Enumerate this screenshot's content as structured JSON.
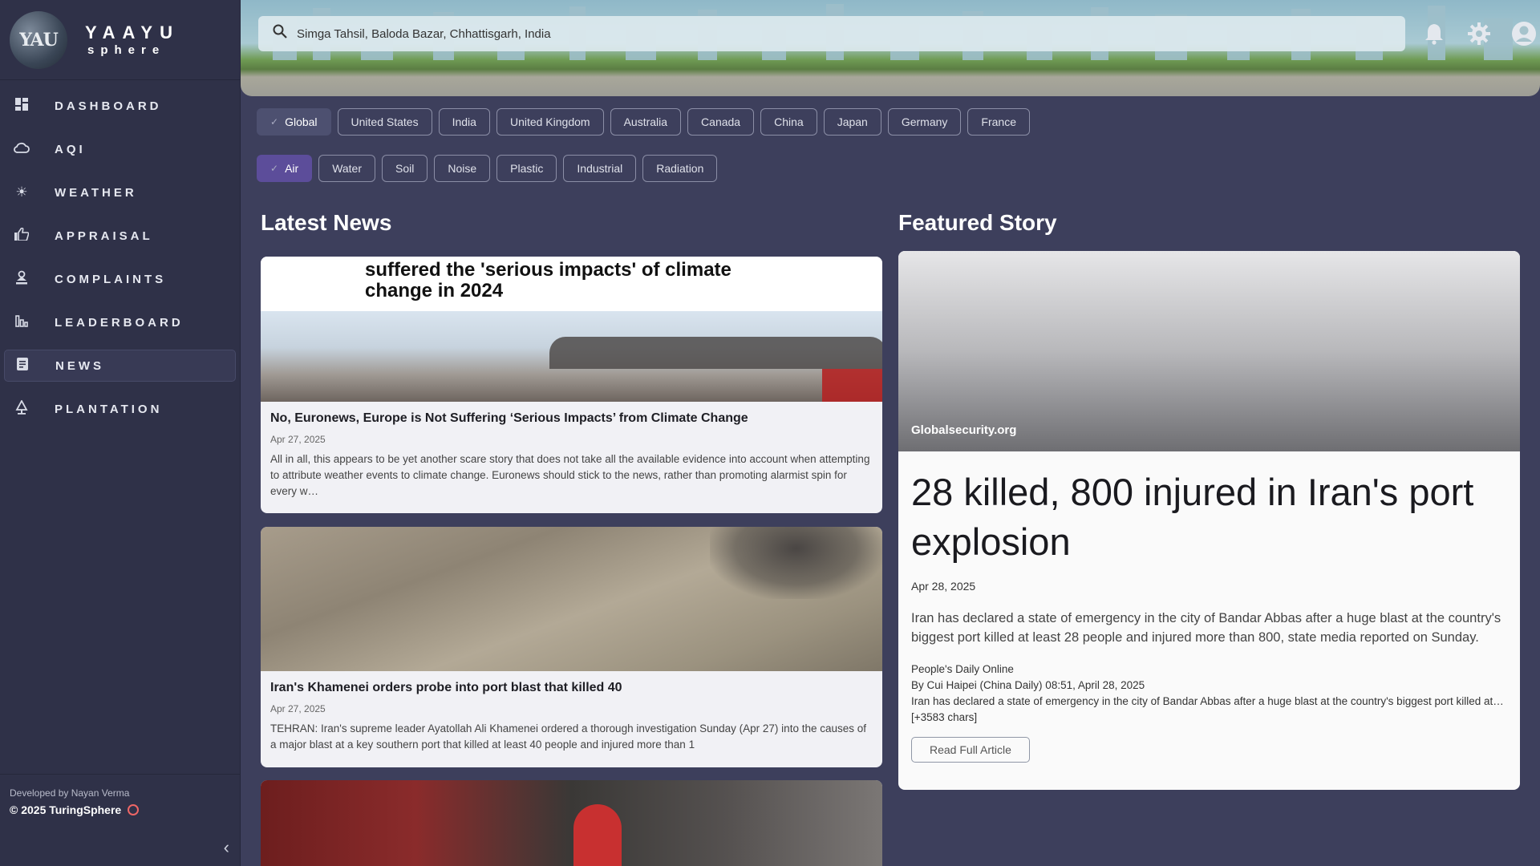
{
  "brand": {
    "logo_text": "YAU",
    "name": "YAAYU",
    "subtitle": "sphere"
  },
  "sidebar": {
    "items": [
      {
        "label": "DASHBOARD",
        "icon": "dashboard-icon"
      },
      {
        "label": "AQI",
        "icon": "cloud-icon"
      },
      {
        "label": "WEATHER",
        "icon": "sun-icon"
      },
      {
        "label": "APPRAISAL",
        "icon": "thumbs-up-icon"
      },
      {
        "label": "COMPLAINTS",
        "icon": "complaint-icon"
      },
      {
        "label": "LEADERBOARD",
        "icon": "bar-chart-icon"
      },
      {
        "label": "NEWS",
        "icon": "article-icon",
        "active": true
      },
      {
        "label": "PLANTATION",
        "icon": "plant-icon"
      }
    ],
    "footer": {
      "developer": "Developed by Nayan Verma",
      "copyright": "© 2025 TuringSphere"
    }
  },
  "header": {
    "search_value": "Simga Tahsil, Baloda Bazar, Chhattisgarh, India",
    "icons": [
      "bell-icon",
      "settings-icon",
      "account-icon"
    ]
  },
  "filters": {
    "countries": [
      "Global",
      "United States",
      "India",
      "United Kingdom",
      "Australia",
      "Canada",
      "China",
      "Japan",
      "Germany",
      "France"
    ],
    "selected_country": "Global",
    "topics": [
      "Air",
      "Water",
      "Soil",
      "Noise",
      "Plastic",
      "Industrial",
      "Radiation"
    ],
    "selected_topic": "Air"
  },
  "latest": {
    "title": "Latest News",
    "articles": [
      {
        "image_caption": "suffered the 'serious impacts' of climate change in 2024",
        "title": "No, Euronews, Europe is Not Suffering ‘Serious Impacts’ from Climate Change",
        "date": "Apr 27, 2025",
        "description": "All in all, this appears to be yet another scare story that does not take all the available evidence into account when attempting to attribute weather events to climate change. Euronews should stick to the news, rather than promoting alarmist spin for every w…"
      },
      {
        "title": "Iran's Khamenei orders probe into port blast that killed 40",
        "date": "Apr 27, 2025",
        "description": "TEHRAN: Iran's supreme leader Ayatollah Ali Khamenei ordered a thorough investigation Sunday (Apr 27) into the causes of a major blast at a key southern port that killed at least 40 people and injured more than 1"
      }
    ]
  },
  "featured": {
    "title": "Featured Story",
    "source": "Globalsecurity.org",
    "headline": "28 killed, 800 injured in Iran's port explosion",
    "date": "Apr 28, 2025",
    "description": "Iran has declared a state of emergency in the city of Bandar Abbas after a huge blast at the country's biggest port killed at least 28 people and injured more than 800, state media reported on Sunday.",
    "publisher": "People's Daily Online",
    "byline": "By Cui Haipei (China Daily) 08:51, April 28, 2025",
    "excerpt": "Iran has declared a state of emergency in the city of Bandar Abbas after a huge blast at the country's biggest port killed at… [+3583 chars]",
    "button": "Read Full Article"
  }
}
